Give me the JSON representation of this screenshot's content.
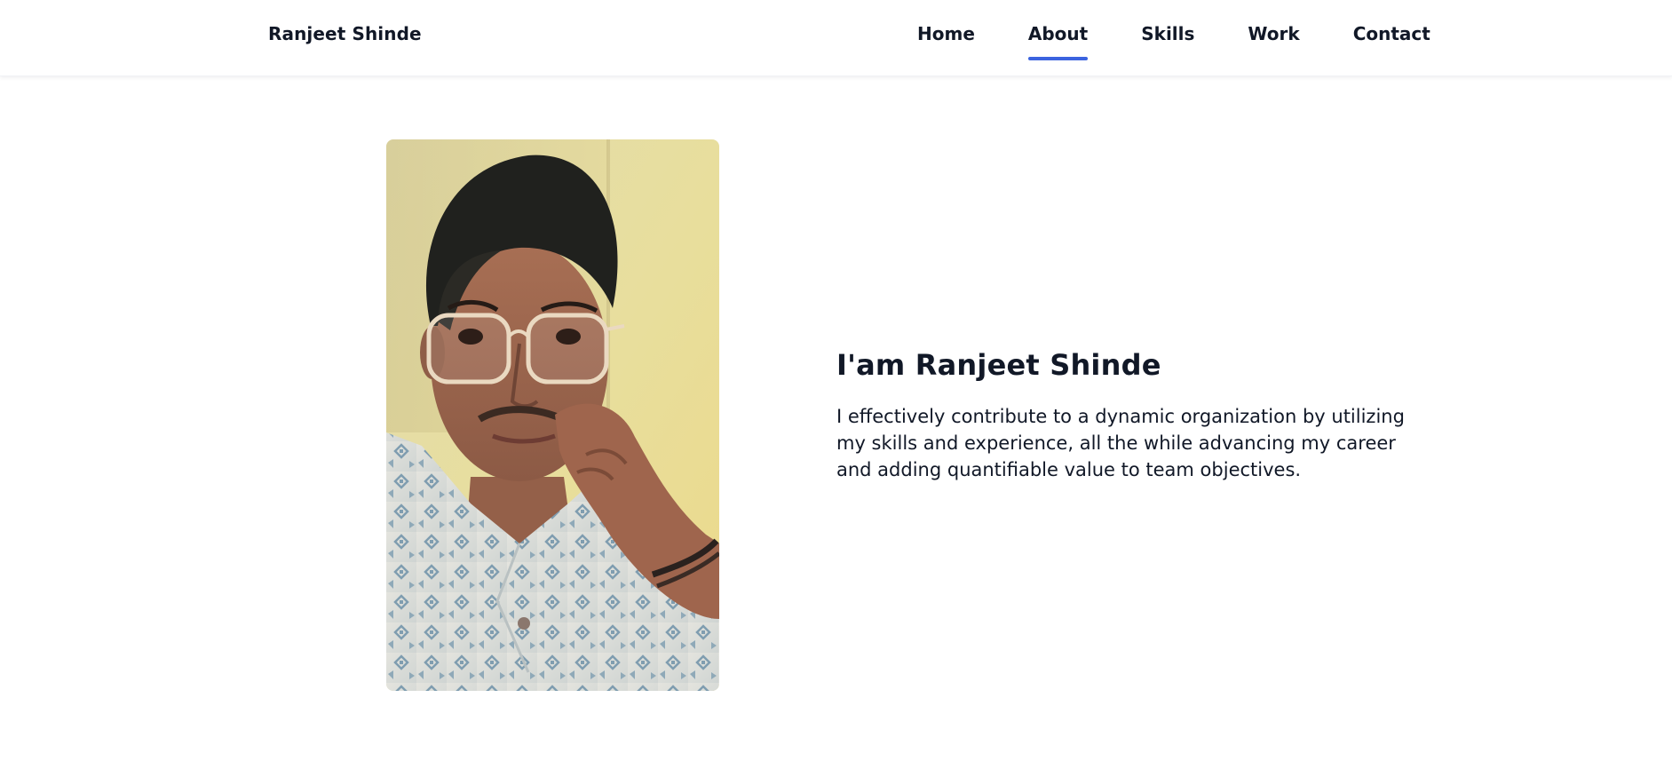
{
  "header": {
    "logo": "Ranjeet Shinde",
    "nav": [
      {
        "label": "Home"
      },
      {
        "label": "About"
      },
      {
        "label": "Skills"
      },
      {
        "label": "Work"
      },
      {
        "label": "Contact"
      }
    ],
    "active_nav": "About"
  },
  "about": {
    "title": "I'am Ranjeet Shinde",
    "description": "I effectively contribute to a dynamic organization by utilizing my skills and experience, all the while advancing my career and adding quantifiable value to team objectives."
  },
  "colors": {
    "accent": "#3b63df",
    "text": "#111827",
    "background": "#ffffff"
  }
}
